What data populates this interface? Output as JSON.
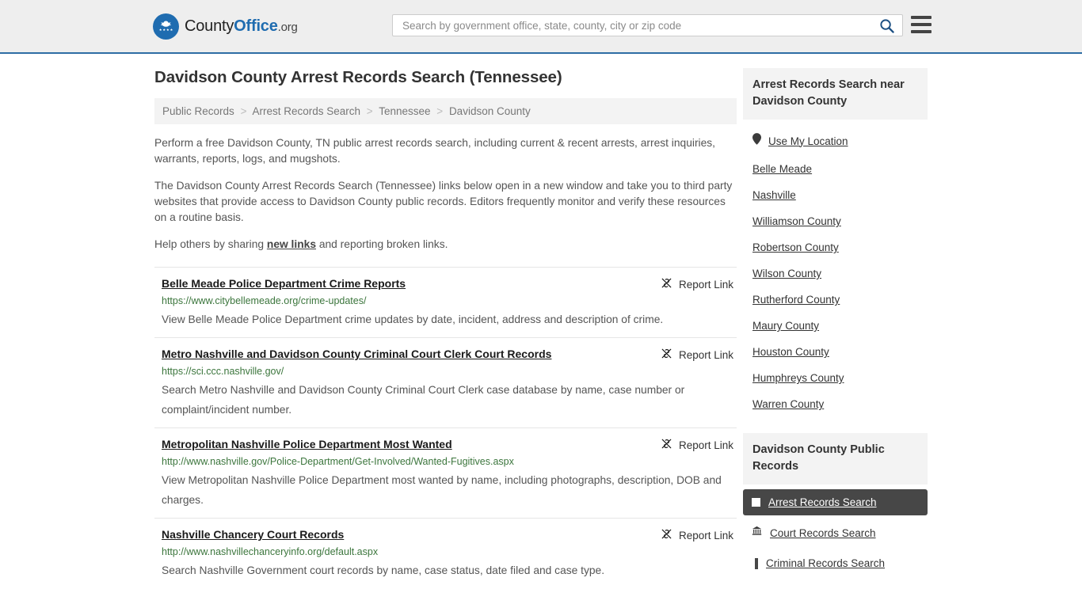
{
  "header": {
    "brand": {
      "part1": "County",
      "part2": "Office",
      "part3": ".org",
      "logo_icon": "eagle-seal-icon"
    },
    "search": {
      "value": "",
      "placeholder": "Search by government office, state, county, city or zip code",
      "icon": "search-icon"
    },
    "menu_icon": "hamburger-menu-icon"
  },
  "page_title": "Davidson County Arrest Records Search (Tennessee)",
  "breadcrumb": {
    "separator": ">",
    "items": [
      "Public Records",
      "Arrest Records Search",
      "Tennessee",
      "Davidson County"
    ]
  },
  "intro": {
    "p1": "Perform a free Davidson County, TN public arrest records search, including current & recent arrests, arrest inquiries, warrants, reports, logs, and mugshots.",
    "p2": "The Davidson County Arrest Records Search (Tennessee) links below open in a new window and take you to third party websites that provide access to Davidson County public records. Editors frequently monitor and verify these resources on a routine basis.",
    "p3_before": "Help others by sharing ",
    "p3_link": "new links",
    "p3_after": " and reporting broken links."
  },
  "report_link_label": "Report Link",
  "report_link_icon": "broken-link-icon",
  "results": [
    {
      "title": "Belle Meade Police Department Crime Reports",
      "url": "https://www.citybellemeade.org/crime-updates/",
      "description": "View Belle Meade Police Department crime updates by date, incident, address and description of crime."
    },
    {
      "title": "Metro Nashville and Davidson County Criminal Court Clerk Court Records",
      "url": "https://sci.ccc.nashville.gov/",
      "description": "Search Metro Nashville and Davidson County Criminal Court Clerk case database by name, case number or complaint/incident number."
    },
    {
      "title": "Metropolitan Nashville Police Department Most Wanted",
      "url": "http://www.nashville.gov/Police-Department/Get-Involved/Wanted-Fugitives.aspx",
      "description": "View Metropolitan Nashville Police Department most wanted by name, including photographs, description, DOB and charges."
    },
    {
      "title": "Nashville Chancery Court Records",
      "url": "http://www.nashvillechanceryinfo.org/default.aspx",
      "description": "Search Nashville Government court records by name, case status, date filed and case type."
    }
  ],
  "sidebar": {
    "nearby": {
      "heading": "Arrest Records Search near Davidson County",
      "use_my_location": {
        "label": "Use My Location",
        "icon": "map-pin-icon"
      },
      "items": [
        "Belle Meade",
        "Nashville",
        "Williamson County",
        "Robertson County",
        "Wilson County",
        "Rutherford County",
        "Maury County",
        "Houston County",
        "Humphreys County",
        "Warren County"
      ]
    },
    "public_records": {
      "heading": "Davidson County Public Records",
      "items": [
        {
          "label": "Arrest Records Search",
          "icon": "handcuffs-icon",
          "active": true
        },
        {
          "label": "Court Records Search",
          "icon": "courthouse-icon",
          "active": false
        },
        {
          "label": "Criminal Records Search",
          "icon": "gavel-icon",
          "active": false
        }
      ]
    }
  },
  "colors": {
    "brand_blue": "#1f6cb0",
    "header_bg": "#eeeeee",
    "header_border": "#2e6da4",
    "url_green": "#3c763d",
    "panel_gray": "#f3f3f3",
    "active_dark": "#474747"
  }
}
